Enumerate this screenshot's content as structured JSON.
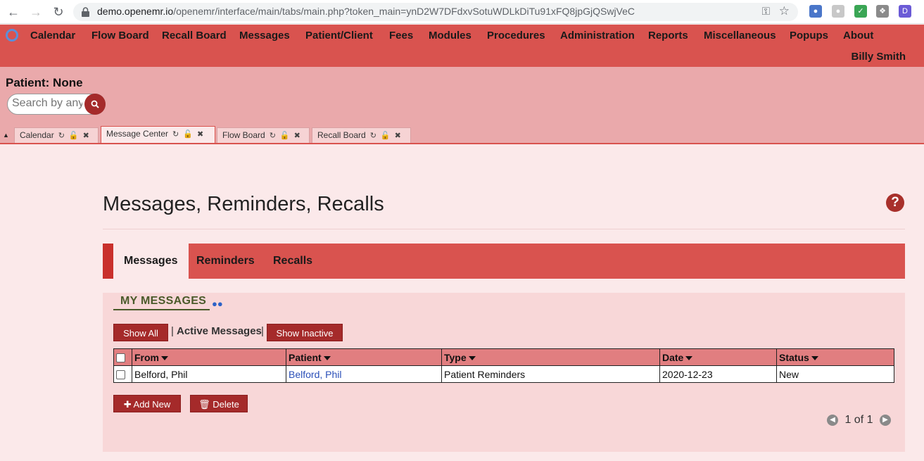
{
  "browser": {
    "url_host": "demo.openemr.io",
    "url_path": "/openemr/interface/main/tabs/main.php?token_main=ynD2W7DFdxvSotuWDLkDiTu91xFQ8jpGjQSwjVeC"
  },
  "menu": {
    "items": [
      "Calendar",
      "Flow Board",
      "Recall Board",
      "Messages",
      "Patient/Client",
      "Fees",
      "Modules",
      "Procedures",
      "Administration",
      "Reports",
      "Miscellaneous",
      "Popups",
      "About"
    ],
    "user": "Billy Smith"
  },
  "patient": {
    "label": "Patient: None",
    "search_placeholder": "Search by any"
  },
  "tabs": [
    "Calendar",
    "Message Center",
    "Flow Board",
    "Recall Board"
  ],
  "page": {
    "title": "Messages, Reminders, Recalls",
    "subtabs": [
      "Messages",
      "Reminders",
      "Recalls"
    ]
  },
  "messages": {
    "section_title": "MY MESSAGES",
    "show_all": "Show All",
    "active_label": "Active Messages",
    "show_inactive": "Show Inactive",
    "columns": [
      "From",
      "Patient",
      "Type",
      "Date",
      "Status"
    ],
    "rows": [
      {
        "from": "Belford, Phil",
        "patient": "Belford, Phil",
        "type": "Patient Reminders",
        "date": "2020-12-23",
        "status": "New"
      }
    ],
    "add_new": "Add New",
    "delete": "Delete",
    "pager": "1 of 1"
  },
  "colors": {
    "brand": "#d9534f",
    "button": "#a52a2a"
  }
}
